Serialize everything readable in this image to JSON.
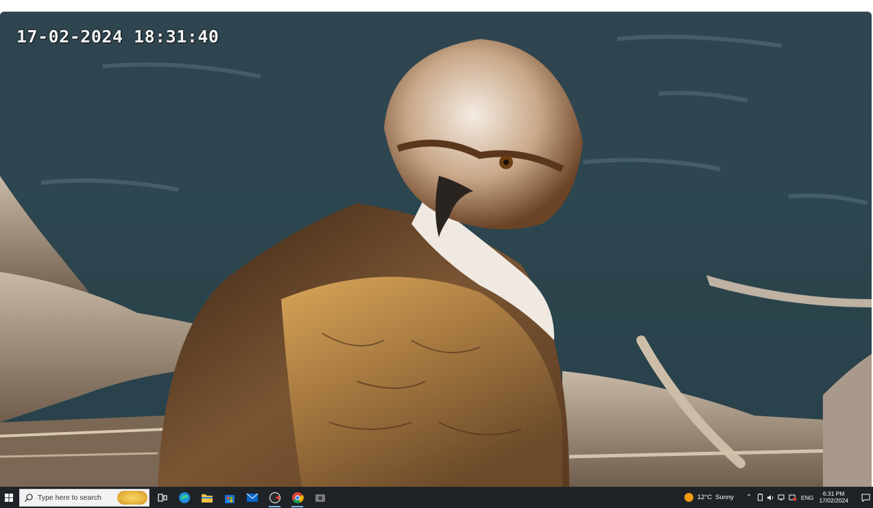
{
  "video": {
    "timestamp": "17-02-2024 18:31:40",
    "subject": "osprey-on-nest"
  },
  "taskbar": {
    "search_placeholder": "Type here to search",
    "apps": [
      {
        "name": "task-view",
        "icon": "task-view-icon"
      },
      {
        "name": "edge",
        "icon": "edge-browser-icon"
      },
      {
        "name": "file-explorer",
        "icon": "folder-icon"
      },
      {
        "name": "store",
        "icon": "store-icon"
      },
      {
        "name": "mail",
        "icon": "mail-icon"
      },
      {
        "name": "app-red",
        "icon": "app-icon"
      },
      {
        "name": "chrome",
        "icon": "chrome-icon"
      },
      {
        "name": "camera-app",
        "icon": "camera-icon"
      }
    ],
    "weather": {
      "temp": "12°C",
      "condition": "Sunny"
    },
    "language": "ENG",
    "time": "6:31 PM",
    "date": "17/02/2024"
  },
  "colors": {
    "water": "#2d4650",
    "taskbar": "#1f2328",
    "accent": "#76b9ed"
  }
}
